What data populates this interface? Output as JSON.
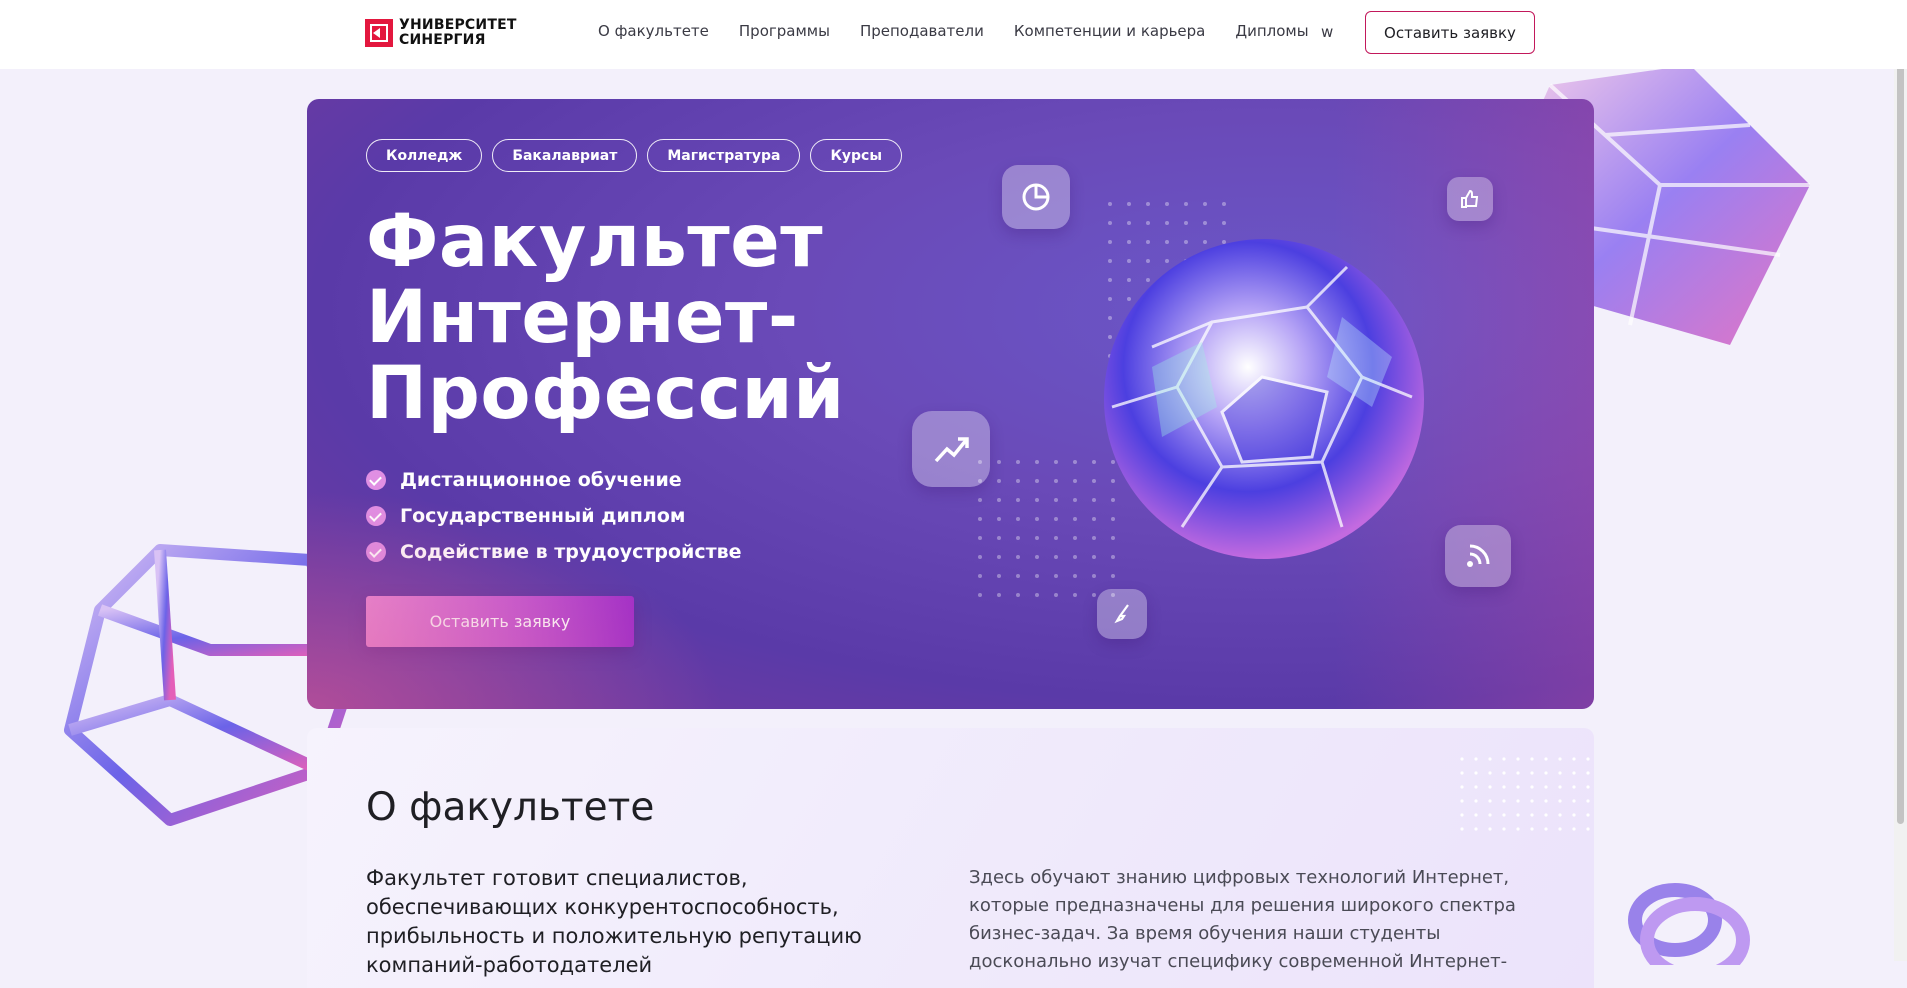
{
  "header": {
    "logo": {
      "line1": "УНИВЕРСИТЕТ",
      "line2": "СИНЕРГИЯ"
    },
    "nav": [
      {
        "label": "О факультете"
      },
      {
        "label": "Программы"
      },
      {
        "label": "Преподаватели"
      },
      {
        "label": "Компетенции и карьера"
      },
      {
        "label": "Дипломы"
      }
    ],
    "extra_label": "w",
    "cta_label": "Оставить заявку"
  },
  "hero": {
    "chips": [
      {
        "label": "Колледж"
      },
      {
        "label": "Бакалавриат"
      },
      {
        "label": "Магистратура"
      },
      {
        "label": "Курсы"
      }
    ],
    "title": "Факультет Интернет-Профессий",
    "features": [
      {
        "label": "Дистанционное обучение"
      },
      {
        "label": "Государственный диплом"
      },
      {
        "label": "Содействие в трудоустройстве"
      }
    ],
    "cta_label": "Оставить заявку",
    "icons": [
      "pie-chart-icon",
      "thumbs-up-icon",
      "trend-up-icon",
      "wifi-signal-icon",
      "brush-icon"
    ]
  },
  "about": {
    "title": "О факультете",
    "lead": "Факультет готовит специалистов, обеспечивающих конкурентоспособность, прибыльность и положительную репутацию компаний-работодателей",
    "text": "Здесь обучают знанию цифровых технологий Интернет, которые предназначены для решения широкого спектра бизнес-задач. За время обучения наши студенты досконально изучат специфику современной Интернет-"
  },
  "colors": {
    "brand": "#e3173e",
    "accent": "#c2185b",
    "hero_bg": "#6a4ab8",
    "cta_gradient_end": "#a230c7"
  }
}
